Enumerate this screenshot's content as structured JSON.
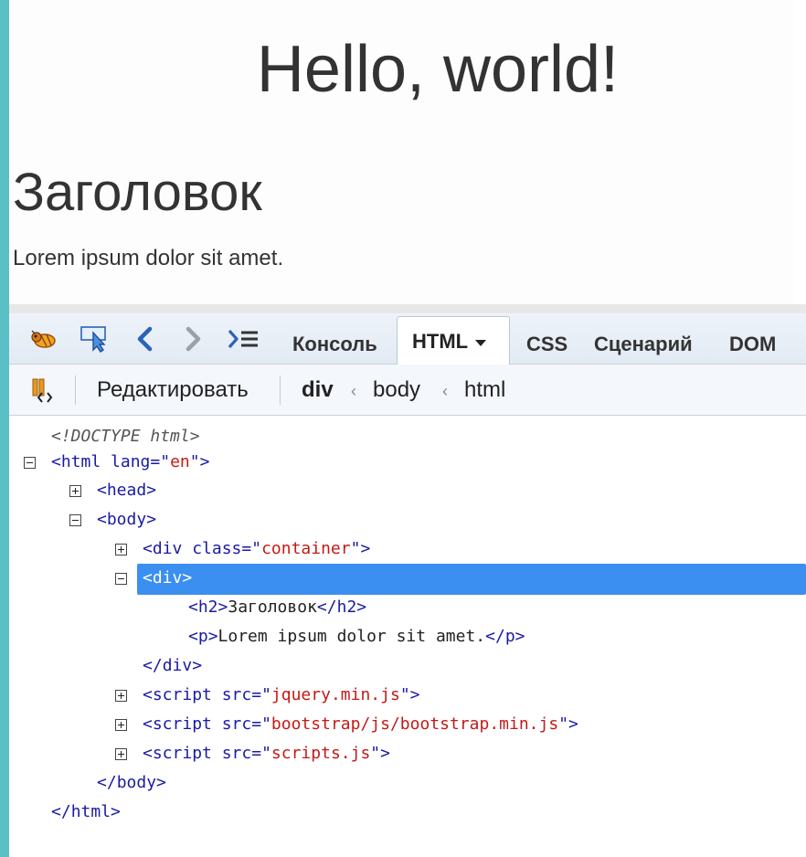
{
  "page": {
    "hello": "Hello, world!",
    "heading": "Заголовок",
    "paragraph": "Lorem ipsum dolor sit amet."
  },
  "devtools": {
    "tabs": [
      "Консоль",
      "HTML",
      "CSS",
      "Сценарий",
      "DOM"
    ],
    "edit_label": "Редактировать",
    "breadcrumb": [
      "div",
      "body",
      "html"
    ],
    "tree": {
      "doctype": "<!DOCTYPE html>",
      "html_tag": "html",
      "lang_attr": "lang",
      "lang_val": "en",
      "head_tag": "head",
      "body_tag": "body",
      "div_tag": "div",
      "class_attr": "class",
      "class_val": "container",
      "h2_tag": "h2",
      "h2_text": "Заголовок",
      "p_tag": "p",
      "p_text": "Lorem ipsum dolor sit amet.",
      "script_tag": "script",
      "src_attr": "src",
      "scripts": [
        "jquery.min.js",
        "bootstrap/js/bootstrap.min.js",
        "scripts.js"
      ]
    }
  },
  "colors": {
    "accent": "#3b8ff0",
    "tag": "#1a1aa6",
    "attr_value": "#c41a16",
    "left_edge": "#5bc0c6"
  }
}
